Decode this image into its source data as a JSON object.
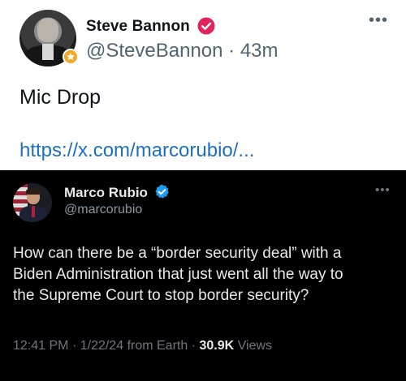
{
  "main_tweet": {
    "author_name": "Steve Bannon",
    "handle": "@SteveBannon",
    "separator": "·",
    "time_ago": "43m",
    "text": "Mic Drop",
    "link": "https://x.com/marcorubio/...",
    "verified_icon": "red-verified-check-icon",
    "avatar_badge_icon": "gold-badge-icon",
    "more_icon": "more-options-icon",
    "colors": {
      "verified": "#e0245e",
      "link": "#1d6fc4",
      "badge": "#f5a623"
    }
  },
  "quoted_tweet": {
    "author_name": "Marco Rubio",
    "handle": "@marcorubio",
    "verified_icon": "blue-verified-check-icon",
    "more_icon": "more-options-icon",
    "text_lines": [
      "How can there be a “border security deal” with a",
      "Biden Administration that just went all the way to",
      "the Supreme Court to stop border security?"
    ],
    "timestamp": "12:41 PM",
    "date": "1/22/24",
    "source": "from Earth",
    "separator": "·",
    "views_count": "30.9K",
    "views_label": "Views",
    "colors": {
      "verified": "#1d9bf0",
      "background": "#000000"
    }
  }
}
